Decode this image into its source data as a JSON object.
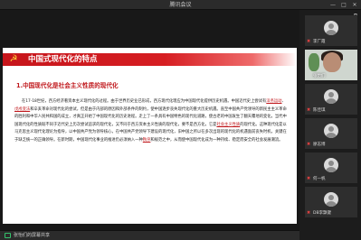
{
  "window": {
    "title": "腾讯会议",
    "controls": [
      "—",
      "□",
      "✕"
    ]
  },
  "slide": {
    "heading": "中国式现代化的特点",
    "subheading": "1.中国现代化是社会主义性质的现代化",
    "paragraph_segments": [
      {
        "text": "在17-18世纪，西方经济看资本主义现代化的过程。由于世界历史业已形成，西方现代化理应为中国现代化提供历史机遇。中国近代史上尝试有",
        "u": false
      },
      {
        "text": "洋务运动",
        "u": true
      },
      {
        "text": "、",
        "u": false
      },
      {
        "text": "戊戌变法",
        "u": true
      },
      {
        "text": "和辛亥革命对现代化的尝试，但是由于内部的原因和外部条件的制约，使中国逐步丧失现代化的重大历史机遇。直至中国共产党领导的新民主主义革命的胜利和中华人民共和国的成立，才真正开始了中国现代化的历史进程。走上了一条具有中国特色的现代化道路，使古老的中国发生了翻天覆地的变化。当代中国现代化的性质既不同于近代史上历次尝试追求的现代化，又不同于西方资本主义性质的现代化，要不是西方化，它是",
        "u": false
      },
      {
        "text": "社会主义性质",
        "u": true
      },
      {
        "text": "的现代化。这种现代化是以马克思主义现代化理论为指导，以中国共产党为领导核心，在中国共产党领导下建设的现代化，旧中国之所以在多次出现的现代化的机遇面前丧失时机，关键在于缺乏统一的正确领导。在新时期，中国现代化事业的推进仍必须纳入一种",
        "u": false
      },
      {
        "text": "秩序",
        "u": true
      },
      {
        "text": "和规范之中，从而使中国现代化成为一种持续、稳定而安全的社会发展潮流。",
        "u": false
      }
    ]
  },
  "bottombar": {
    "share_label": "张怡们的屏幕共享"
  },
  "participants": [
    {
      "name": "李广霞",
      "type": "avatar",
      "muted": true
    },
    {
      "name": "张怡们",
      "type": "video",
      "muted": false
    },
    {
      "name": "陈佳琪",
      "type": "avatar",
      "muted": true
    },
    {
      "name": "廖志博",
      "type": "avatar",
      "muted": true
    },
    {
      "name": "何一帆",
      "type": "avatar",
      "muted": true
    },
    {
      "name": "DB李飘键",
      "type": "avatar",
      "muted": true
    }
  ],
  "colors": {
    "banner_red": "#c6151b",
    "subheading_red": "#c0181c",
    "share_green": "#34c26b"
  }
}
